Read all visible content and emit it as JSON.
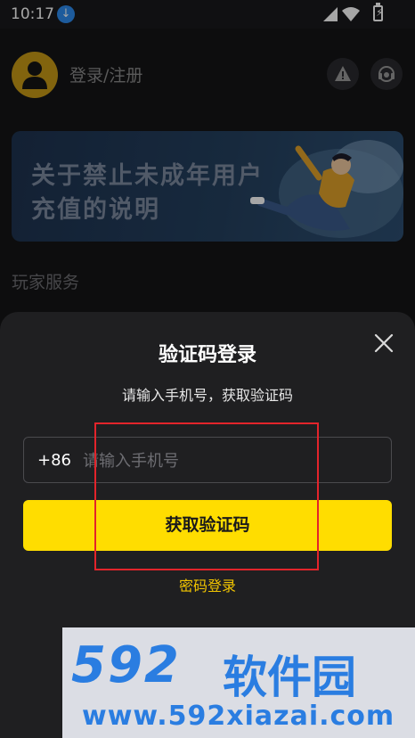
{
  "status_bar": {
    "time": "10:17"
  },
  "header": {
    "login_label": "登录/注册"
  },
  "banner": {
    "line1": "关于禁止未成年用户",
    "line2": "充值的说明"
  },
  "section": {
    "title": "玩家服务"
  },
  "login_sheet": {
    "title": "验证码登录",
    "subtitle": "请输入手机号，获取验证码",
    "country_code": "+86",
    "phone_placeholder": "请输入手机号",
    "phone_value": "",
    "get_code_label": "获取验证码",
    "password_login_label": "密码登录"
  },
  "watermark": {
    "logo_digits": "592",
    "logo_text": "软件园",
    "url": "www.592xiazai.com"
  },
  "colors": {
    "accent": "#ffdd00",
    "link": "#f2c500",
    "sheet_bg": "#1f1f21",
    "page_bg": "#141416",
    "highlight": "#e3242b",
    "watermark": "#2a7de1"
  }
}
